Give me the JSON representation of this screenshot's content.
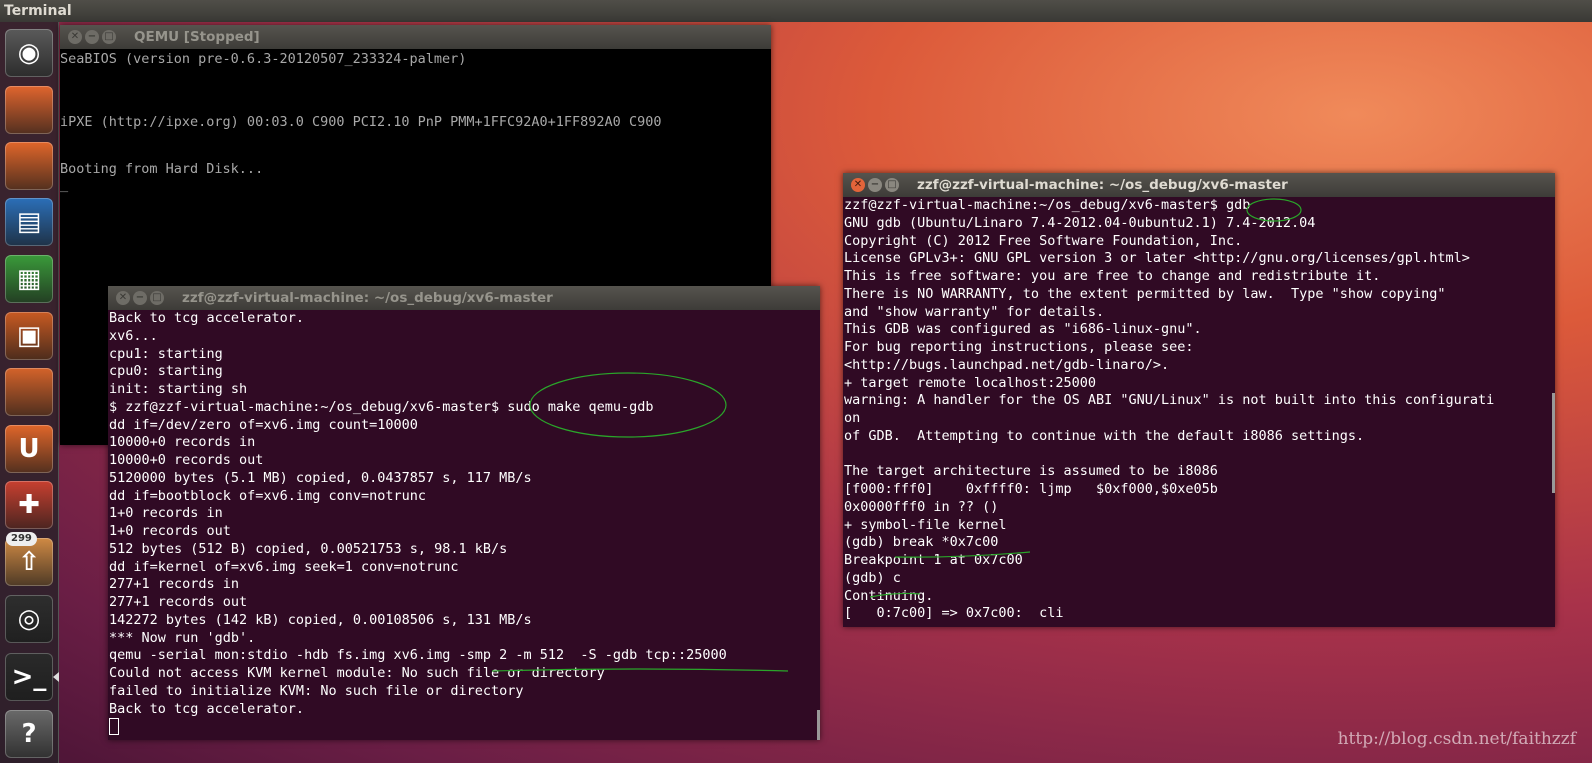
{
  "topbar": {
    "title": "Terminal"
  },
  "launcher": {
    "items": [
      {
        "name": "dash-home-icon",
        "glyph": "◉",
        "color": "#5a5a5a"
      },
      {
        "name": "files-folder-icon",
        "glyph": "",
        "color": "#e0652e"
      },
      {
        "name": "firefox-icon",
        "glyph": "",
        "color": "#e0662a"
      },
      {
        "name": "libreoffice-writer-icon",
        "glyph": "▤",
        "color": "#2b6fb8"
      },
      {
        "name": "libreoffice-calc-icon",
        "glyph": "▦",
        "color": "#3a9a3a"
      },
      {
        "name": "libreoffice-impress-icon",
        "glyph": "▣",
        "color": "#c85a22"
      },
      {
        "name": "software-center-icon",
        "glyph": "",
        "color": "#d4632a"
      },
      {
        "name": "ubuntu-one-icon",
        "glyph": "U",
        "color": "#e0662a"
      },
      {
        "name": "system-settings-icon",
        "glyph": "✚",
        "color": "#c84030"
      },
      {
        "name": "update-manager-icon",
        "glyph": "⇧",
        "color": "#d08a44",
        "badge": "299"
      },
      {
        "name": "disk-icon",
        "glyph": "◎",
        "color": "#2e2e2e"
      },
      {
        "name": "terminal-icon",
        "glyph": ">_",
        "color": "#2a2a2a",
        "active": true
      },
      {
        "name": "help-icon",
        "glyph": "?",
        "color": "#6a6a6a"
      }
    ]
  },
  "qemu": {
    "title": "QEMU [Stopped]",
    "lines": [
      "SeaBIOS (version pre-0.6.3-20120507_233324-palmer)",
      "iPXE (http://ipxe.org) 00:03.0 C900 PCI2.10 PnP PMM+1FFC92A0+1FF892A0 C900",
      "Booting from Hard Disk...",
      "_"
    ]
  },
  "term1": {
    "title": "zzf@zzf-virtual-machine: ~/os_debug/xv6-master",
    "lines": [
      "Back to tcg accelerator.",
      "xv6...",
      "cpu1: starting",
      "cpu0: starting",
      "init: starting sh",
      "$ zzf@zzf-virtual-machine:~/os_debug/xv6-master$ sudo make qemu-gdb",
      "dd if=/dev/zero of=xv6.img count=10000",
      "10000+0 records in",
      "10000+0 records out",
      "5120000 bytes (5.1 MB) copied, 0.0437857 s, 117 MB/s",
      "dd if=bootblock of=xv6.img conv=notrunc",
      "1+0 records in",
      "1+0 records out",
      "512 bytes (512 B) copied, 0.00521753 s, 98.1 kB/s",
      "dd if=kernel of=xv6.img seek=1 conv=notrunc",
      "277+1 records in",
      "277+1 records out",
      "142272 bytes (142 kB) copied, 0.00108506 s, 131 MB/s",
      "*** Now run 'gdb'.",
      "qemu -serial mon:stdio -hdb fs.img xv6.img -smp 2 -m 512  -S -gdb tcp::25000",
      "Could not access KVM kernel module: No such file or directory",
      "failed to initialize KVM: No such file or directory",
      "Back to tcg accelerator.",
      ""
    ]
  },
  "term2": {
    "title": "zzf@zzf-virtual-machine: ~/os_debug/xv6-master",
    "lines": [
      "zzf@zzf-virtual-machine:~/os_debug/xv6-master$ gdb",
      "GNU gdb (Ubuntu/Linaro 7.4-2012.04-0ubuntu2.1) 7.4-2012.04",
      "Copyright (C) 2012 Free Software Foundation, Inc.",
      "License GPLv3+: GNU GPL version 3 or later <http://gnu.org/licenses/gpl.html>",
      "This is free software: you are free to change and redistribute it.",
      "There is NO WARRANTY, to the extent permitted by law.  Type \"show copying\"",
      "and \"show warranty\" for details.",
      "This GDB was configured as \"i686-linux-gnu\".",
      "For bug reporting instructions, please see:",
      "<http://bugs.launchpad.net/gdb-linaro/>.",
      "+ target remote localhost:25000",
      "warning: A handler for the OS ABI \"GNU/Linux\" is not built into this configurati",
      "on",
      "of GDB.  Attempting to continue with the default i8086 settings.",
      "",
      "The target architecture is assumed to be i8086",
      "[f000:fff0]    0xffff0: ljmp   $0xf000,$0xe05b",
      "0x0000fff0 in ?? ()",
      "+ symbol-file kernel",
      "(gdb) break *0x7c00",
      "Breakpoint 1 at 0x7c00",
      "(gdb) c",
      "Continuing.",
      "[   0:7c00] => 0x7c00:  cli"
    ]
  },
  "watermark": "http://blog.csdn.net/faithzzf",
  "colors": {
    "terminal_bg": "#300a24",
    "annotation": "#2aa52a",
    "close_button": "#e2643a"
  }
}
